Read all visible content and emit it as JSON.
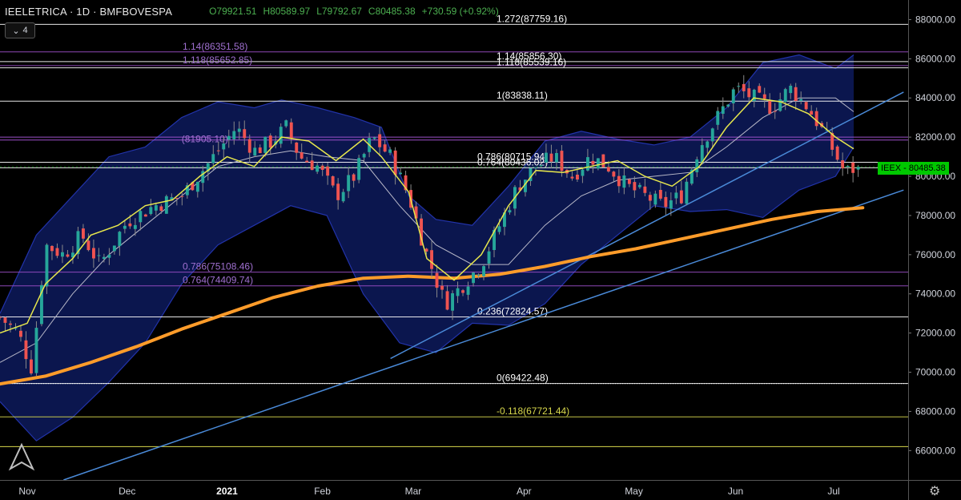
{
  "header": {
    "title": "IEELETRICA · 1D · BMFBOVESPA",
    "open": "O79921.51",
    "high": "H80589.97",
    "low": "L79792.67",
    "close": "C80485.38",
    "change": "+730.59 (+0.92%)",
    "indicator_count": "4"
  },
  "price_tag": "IEEX - 80485.38",
  "colors": {
    "background": "#000000",
    "up": "#26a69a",
    "down": "#ef5350",
    "bollinger_fill": "#0d1a5c",
    "bollinger_edge": "#2233aa",
    "ema_short": "#e6e64c",
    "sma_mid": "#b8b8c8",
    "ma_long": "#ff9c2a",
    "trendline": "#4a8ad8"
  },
  "chart_data": {
    "type": "candlestick",
    "title": "IEELETRICA · 1D · BMFBOVESPA",
    "ylim": [
      64500,
      89000
    ],
    "y_ticks": [
      66000,
      68000,
      70000,
      72000,
      74000,
      76000,
      78000,
      80000,
      82000,
      84000,
      86000,
      88000
    ],
    "y_tick_labels": [
      "66000.00",
      "68000.00",
      "70000.00",
      "72000.00",
      "74000.00",
      "76000.00",
      "78000.00",
      "80000.00",
      "82000.00",
      "84000.00",
      "86000.00",
      "88000.00"
    ],
    "x_labels": [
      {
        "label": "Nov",
        "t": 0.03
      },
      {
        "label": "Dec",
        "t": 0.14
      },
      {
        "label": "2021",
        "t": 0.25
      },
      {
        "label": "Feb",
        "t": 0.355
      },
      {
        "label": "Mar",
        "t": 0.455
      },
      {
        "label": "Apr",
        "t": 0.577
      },
      {
        "label": "May",
        "t": 0.698
      },
      {
        "label": "Jun",
        "t": 0.81
      },
      {
        "label": "Jul",
        "t": 0.918
      }
    ],
    "fib_levels": [
      {
        "label": "1.272(87759.16)",
        "value": 87759.16,
        "color": "#ffffff",
        "side": "center"
      },
      {
        "label": "1.14(86351.58)",
        "value": 86351.58,
        "color": "#9c4fc8",
        "side": "left"
      },
      {
        "label": "1.14(85856.30)",
        "value": 85856.3,
        "color": "#ffffff",
        "side": "center"
      },
      {
        "label": "1.118(85652.85)",
        "value": 85652.85,
        "color": "#9c4fc8",
        "side": "left"
      },
      {
        "label": "1.118(85539.16)",
        "value": 85539.16,
        "color": "#ffffff",
        "side": "center"
      },
      {
        "label": "1(83838.11)",
        "value": 83838.11,
        "color": "#ffffff",
        "side": "center"
      },
      {
        "label": "0.786(80715.94)",
        "value": 80715.94,
        "color": "#ffffff",
        "side": "center"
      },
      {
        "label": "0.764(80436.02)",
        "value": 80436.02,
        "color": "#ffffff",
        "side": "center"
      },
      {
        "label": "0.786(75108.46)",
        "value": 75108.46,
        "color": "#9c4fc8",
        "side": "left"
      },
      {
        "label": "0.764(74409.74)",
        "value": 74409.74,
        "color": "#9c4fc8",
        "side": "left"
      },
      {
        "label": "0.236(72824.57)",
        "value": 72824.57,
        "color": "#ffffff",
        "side": "center"
      },
      {
        "label": "0(69422.48)",
        "value": 69422.48,
        "color": "#ffffff",
        "side": "center"
      },
      {
        "label": "-0.118(67721.44)",
        "value": 67721.44,
        "color": "#d8d84c",
        "side": "center"
      }
    ],
    "extra_levels": [
      {
        "value": 82000,
        "color": "#9c4fc8"
      },
      {
        "value": 81850,
        "color": "#9c4fc8"
      },
      {
        "value": 66200,
        "color": "#d8d84c"
      }
    ],
    "partial_label": {
      "label": "(81905.10)",
      "value": 81905.1,
      "t": 0.2
    },
    "trendlines": [
      {
        "t0": 0.43,
        "v0": 70700,
        "t1": 0.995,
        "v1": 84300
      },
      {
        "t0": 0.07,
        "v0": 64500,
        "t1": 0.995,
        "v1": 79300
      }
    ],
    "long_ma": [
      [
        0.0,
        69400
      ],
      [
        0.05,
        69800
      ],
      [
        0.1,
        70500
      ],
      [
        0.15,
        71300
      ],
      [
        0.2,
        72200
      ],
      [
        0.25,
        73000
      ],
      [
        0.3,
        73800
      ],
      [
        0.35,
        74400
      ],
      [
        0.4,
        74800
      ],
      [
        0.45,
        74900
      ],
      [
        0.5,
        74800
      ],
      [
        0.55,
        75000
      ],
      [
        0.6,
        75400
      ],
      [
        0.65,
        75900
      ],
      [
        0.7,
        76300
      ],
      [
        0.75,
        76800
      ],
      [
        0.8,
        77300
      ],
      [
        0.85,
        77800
      ],
      [
        0.9,
        78200
      ],
      [
        0.95,
        78400
      ]
    ],
    "ema_short": [
      [
        0.0,
        72000
      ],
      [
        0.03,
        72500
      ],
      [
        0.05,
        74500
      ],
      [
        0.08,
        75800
      ],
      [
        0.1,
        77000
      ],
      [
        0.13,
        77500
      ],
      [
        0.16,
        78500
      ],
      [
        0.19,
        78800
      ],
      [
        0.22,
        80000
      ],
      [
        0.25,
        81000
      ],
      [
        0.28,
        80500
      ],
      [
        0.31,
        82000
      ],
      [
        0.34,
        81800
      ],
      [
        0.37,
        80800
      ],
      [
        0.4,
        81900
      ],
      [
        0.42,
        81000
      ],
      [
        0.45,
        79200
      ],
      [
        0.47,
        75800
      ],
      [
        0.5,
        74700
      ],
      [
        0.53,
        76000
      ],
      [
        0.56,
        78500
      ],
      [
        0.59,
        80300
      ],
      [
        0.62,
        80200
      ],
      [
        0.65,
        80500
      ],
      [
        0.68,
        80800
      ],
      [
        0.71,
        80000
      ],
      [
        0.74,
        79500
      ],
      [
        0.77,
        80500
      ],
      [
        0.8,
        82500
      ],
      [
        0.83,
        84000
      ],
      [
        0.86,
        83800
      ],
      [
        0.89,
        83200
      ],
      [
        0.92,
        82000
      ],
      [
        0.94,
        81400
      ]
    ],
    "sma_mid": [
      [
        0.0,
        70500
      ],
      [
        0.04,
        71500
      ],
      [
        0.08,
        74000
      ],
      [
        0.12,
        76000
      ],
      [
        0.16,
        77500
      ],
      [
        0.2,
        79000
      ],
      [
        0.24,
        80500
      ],
      [
        0.28,
        81000
      ],
      [
        0.32,
        81300
      ],
      [
        0.36,
        81000
      ],
      [
        0.4,
        80800
      ],
      [
        0.44,
        78500
      ],
      [
        0.48,
        76500
      ],
      [
        0.52,
        75500
      ],
      [
        0.56,
        75500
      ],
      [
        0.6,
        77500
      ],
      [
        0.64,
        79000
      ],
      [
        0.68,
        79800
      ],
      [
        0.72,
        80000
      ],
      [
        0.76,
        80200
      ],
      [
        0.8,
        81500
      ],
      [
        0.84,
        83000
      ],
      [
        0.88,
        84000
      ],
      [
        0.92,
        84000
      ],
      [
        0.94,
        83300
      ]
    ],
    "bb_upper": [
      [
        0.0,
        73000
      ],
      [
        0.04,
        77000
      ],
      [
        0.08,
        79000
      ],
      [
        0.12,
        81000
      ],
      [
        0.16,
        81500
      ],
      [
        0.2,
        83000
      ],
      [
        0.24,
        83800
      ],
      [
        0.28,
        83500
      ],
      [
        0.31,
        83900
      ],
      [
        0.35,
        83500
      ],
      [
        0.39,
        83000
      ],
      [
        0.42,
        82500
      ],
      [
        0.45,
        79000
      ],
      [
        0.48,
        77800
      ],
      [
        0.52,
        77500
      ],
      [
        0.56,
        79500
      ],
      [
        0.6,
        81800
      ],
      [
        0.64,
        82300
      ],
      [
        0.68,
        81900
      ],
      [
        0.72,
        81600
      ],
      [
        0.76,
        82000
      ],
      [
        0.8,
        83500
      ],
      [
        0.84,
        85800
      ],
      [
        0.88,
        86200
      ],
      [
        0.92,
        85500
      ],
      [
        0.94,
        86200
      ]
    ],
    "bb_lower": [
      [
        0.0,
        68500
      ],
      [
        0.04,
        66500
      ],
      [
        0.08,
        67700
      ],
      [
        0.12,
        69500
      ],
      [
        0.16,
        71500
      ],
      [
        0.2,
        74500
      ],
      [
        0.24,
        76500
      ],
      [
        0.28,
        77500
      ],
      [
        0.32,
        78500
      ],
      [
        0.36,
        78000
      ],
      [
        0.4,
        74000
      ],
      [
        0.44,
        71500
      ],
      [
        0.48,
        71000
      ],
      [
        0.52,
        72500
      ],
      [
        0.56,
        72400
      ],
      [
        0.6,
        73500
      ],
      [
        0.64,
        75500
      ],
      [
        0.68,
        77000
      ],
      [
        0.72,
        78500
      ],
      [
        0.76,
        78200
      ],
      [
        0.8,
        78300
      ],
      [
        0.84,
        77900
      ],
      [
        0.88,
        79300
      ],
      [
        0.92,
        80000
      ],
      [
        0.94,
        81500
      ]
    ],
    "price_path": [
      [
        0.0,
        72800
      ],
      [
        0.02,
        72000
      ],
      [
        0.035,
        70200
      ],
      [
        0.05,
        76500
      ],
      [
        0.07,
        76000
      ],
      [
        0.09,
        77000
      ],
      [
        0.11,
        75500
      ],
      [
        0.14,
        77700
      ],
      [
        0.17,
        78500
      ],
      [
        0.2,
        79000
      ],
      [
        0.23,
        80700
      ],
      [
        0.26,
        82500
      ],
      [
        0.28,
        81300
      ],
      [
        0.3,
        81800
      ],
      [
        0.315,
        82500
      ],
      [
        0.33,
        81000
      ],
      [
        0.35,
        80500
      ],
      [
        0.37,
        79000
      ],
      [
        0.39,
        80000
      ],
      [
        0.41,
        82000
      ],
      [
        0.43,
        81000
      ],
      [
        0.45,
        79000
      ],
      [
        0.47,
        76000
      ],
      [
        0.49,
        73500
      ],
      [
        0.51,
        74500
      ],
      [
        0.53,
        75500
      ],
      [
        0.55,
        77500
      ],
      [
        0.57,
        79500
      ],
      [
        0.59,
        80500
      ],
      [
        0.61,
        81000
      ],
      [
        0.63,
        80000
      ],
      [
        0.65,
        81000
      ],
      [
        0.67,
        80500
      ],
      [
        0.69,
        79500
      ],
      [
        0.71,
        79000
      ],
      [
        0.73,
        78500
      ],
      [
        0.75,
        79000
      ],
      [
        0.77,
        81500
      ],
      [
        0.79,
        83000
      ],
      [
        0.81,
        84500
      ],
      [
        0.83,
        84000
      ],
      [
        0.85,
        83500
      ],
      [
        0.87,
        84500
      ],
      [
        0.89,
        83500
      ],
      [
        0.91,
        82000
      ],
      [
        0.93,
        80200
      ],
      [
        0.945,
        80485
      ]
    ],
    "last_close": 80485.38
  }
}
